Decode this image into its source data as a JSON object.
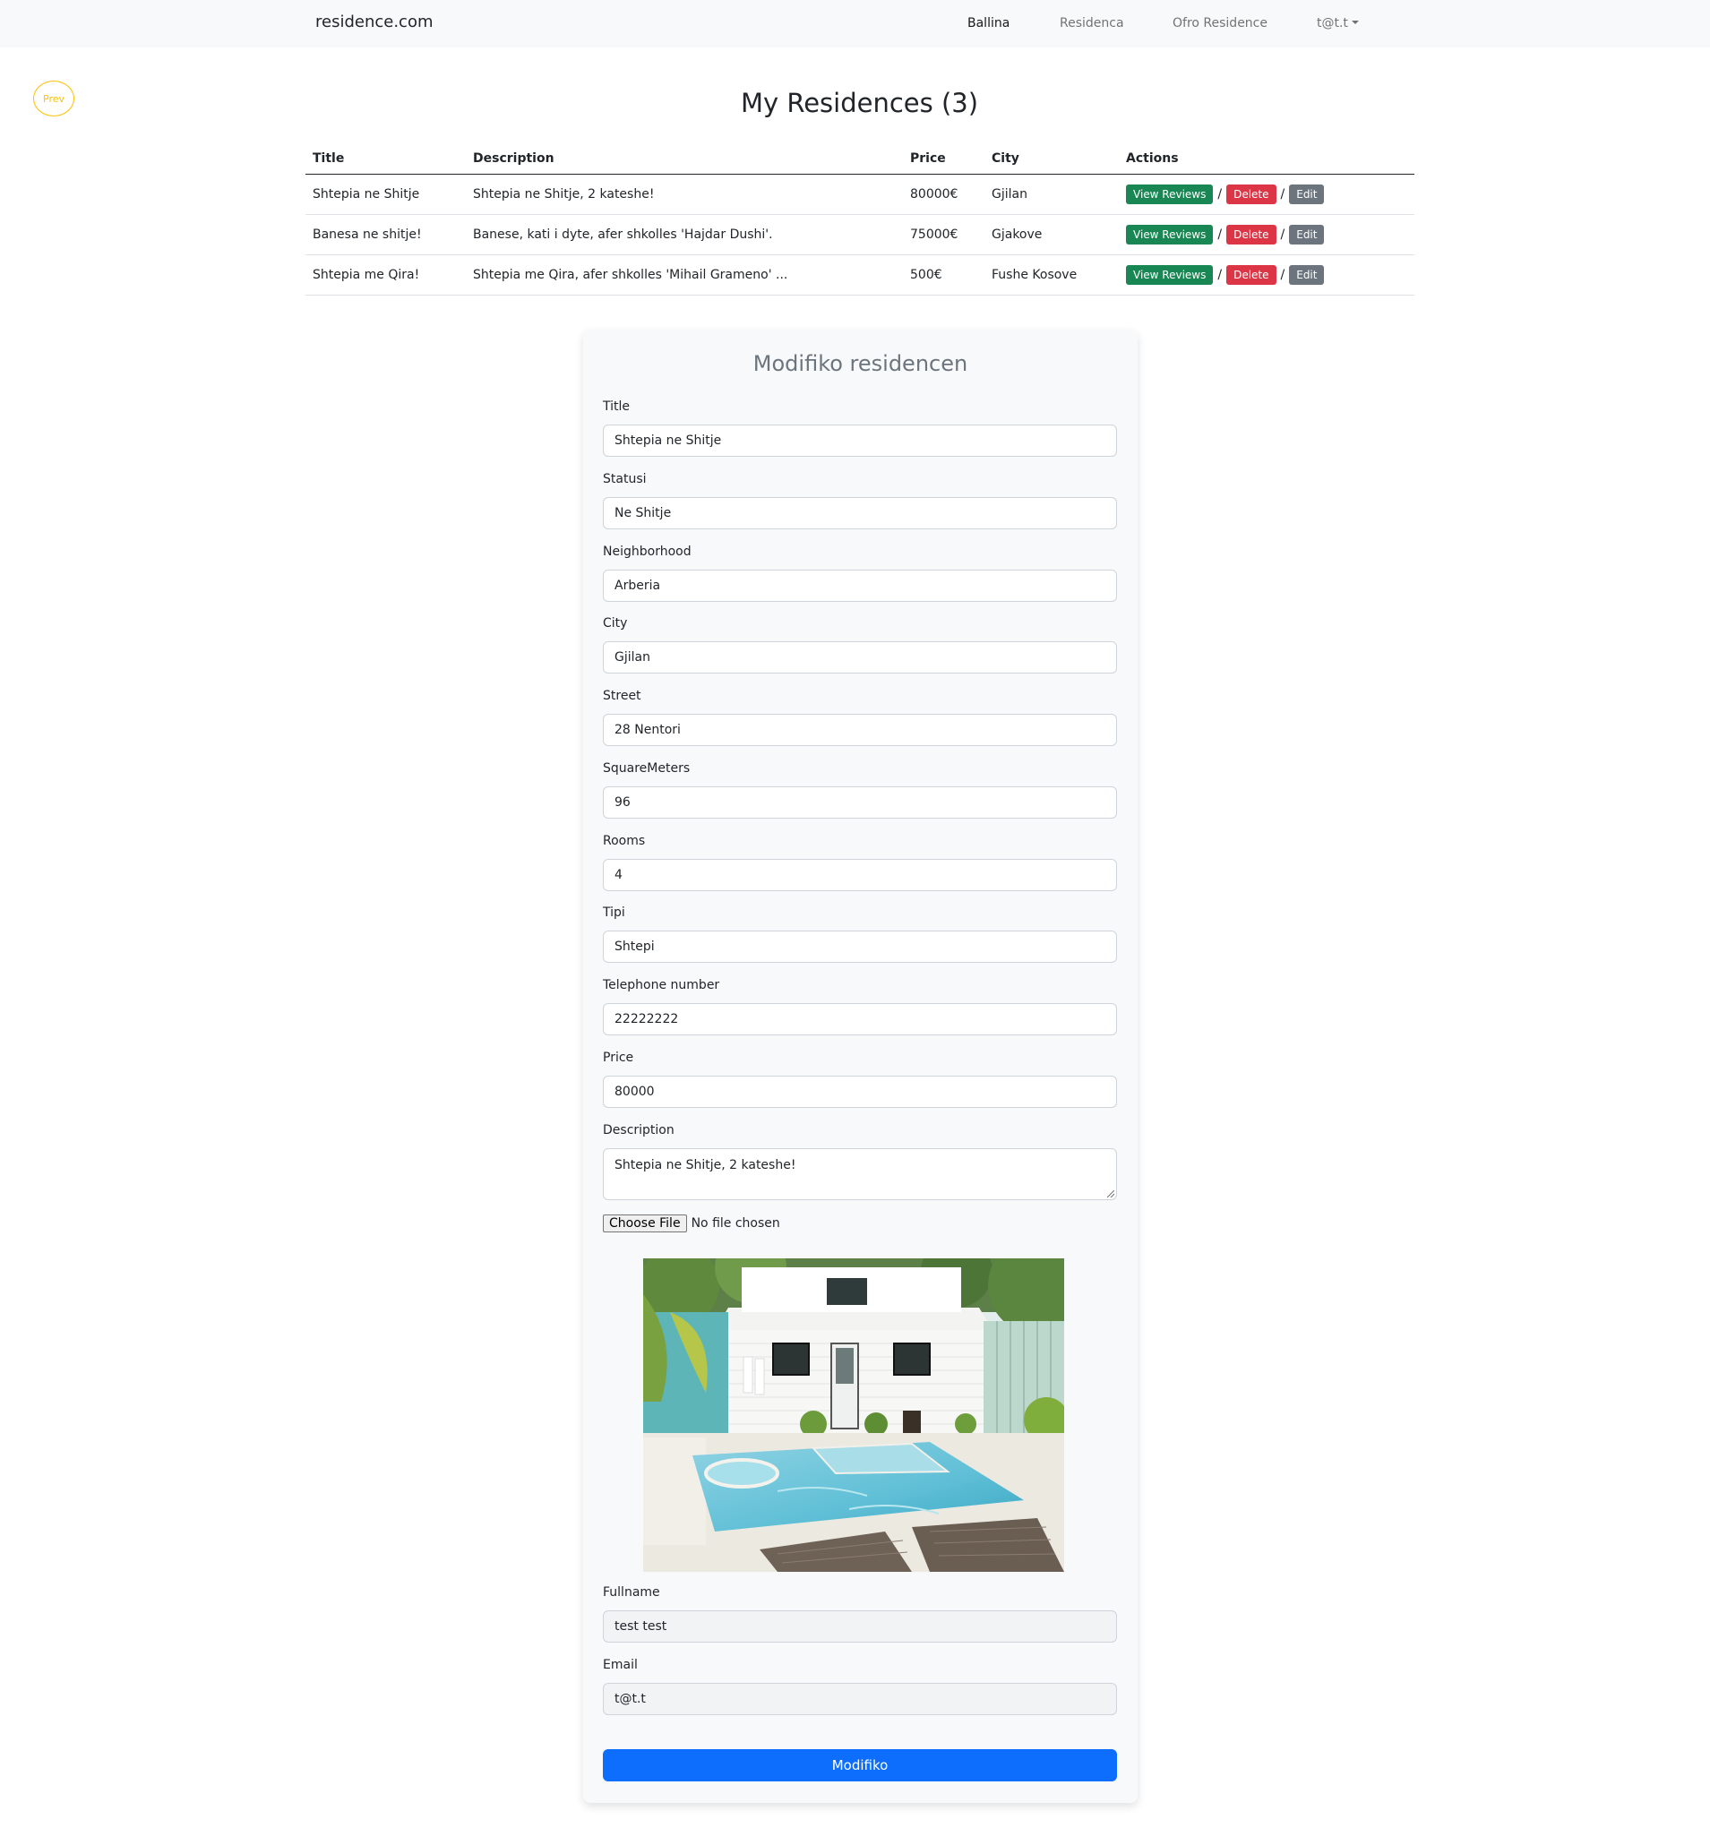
{
  "navbar": {
    "brand": "residence.com",
    "links": [
      "Ballina",
      "Residenca",
      "Ofro Residence"
    ],
    "user": "t@t.t"
  },
  "prev_label": "Prev",
  "page_title": "My Residences (3)",
  "table": {
    "headers": [
      "Title",
      "Description",
      "Price",
      "City",
      "Actions"
    ],
    "rows": [
      {
        "title": "Shtepia ne Shitje",
        "description": "Shtepia ne Shitje, 2 kateshe!",
        "price": "80000€",
        "city": "Gjilan"
      },
      {
        "title": "Banesa ne shitje!",
        "description": "Banese, kati i dyte, afer shkolles 'Hajdar Dushi'.",
        "price": "75000€",
        "city": "Gjakove"
      },
      {
        "title": "Shtepia me Qira!",
        "description": "Shtepia me Qira, afer shkolles 'Mihail Grameno' ...",
        "price": "500€",
        "city": "Fushe Kosove"
      }
    ],
    "actions": {
      "view": "View Reviews",
      "delete": "Delete",
      "edit": "Edit",
      "separator": "/"
    }
  },
  "form": {
    "title": "Modifiko residencen",
    "fields": [
      {
        "label": "Title",
        "value": "Shtepia ne Shitje"
      },
      {
        "label": "Statusi",
        "value": "Ne Shitje"
      },
      {
        "label": "Neighborhood",
        "value": "Arberia"
      },
      {
        "label": "City",
        "value": "Gjilan"
      },
      {
        "label": "Street",
        "value": "28 Nentori"
      },
      {
        "label": "SquareMeters",
        "value": "96"
      },
      {
        "label": "Rooms",
        "value": "4"
      },
      {
        "label": "Tipi",
        "value": "Shtepi"
      },
      {
        "label": "Telephone number",
        "value": "22222222"
      },
      {
        "label": "Price",
        "value": "80000"
      }
    ],
    "description": {
      "label": "Description",
      "value": "Shtepia ne Shitje, 2 kateshe!"
    },
    "file": {
      "button": "Choose File",
      "status": "No file chosen"
    },
    "fullname": {
      "label": "Fullname",
      "value": "test test"
    },
    "email": {
      "label": "Email",
      "value": "t@t.t"
    },
    "submit": "Modifiko"
  },
  "colors": {
    "primary": "#0d6efd",
    "success": "#198754",
    "danger": "#dc3545",
    "secondary": "#6c757d",
    "warning": "#ffc107"
  }
}
